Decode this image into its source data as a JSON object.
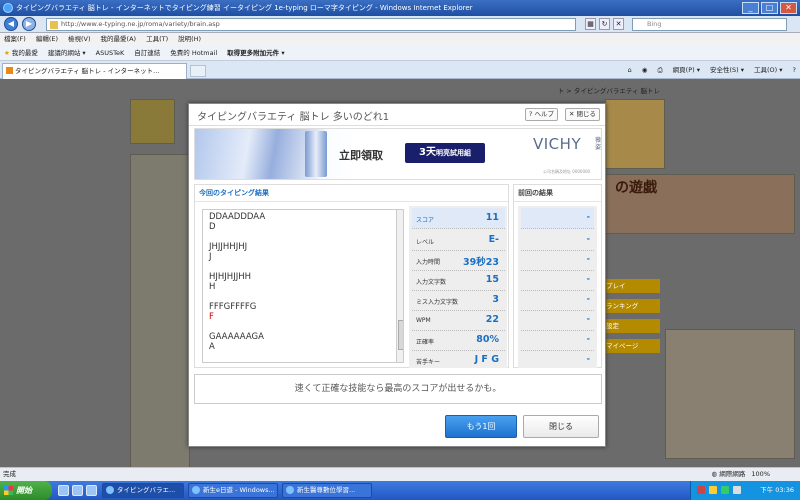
{
  "window": {
    "title": "タイピングバラエティ 脳トレ - インターネットでタイピング練習 イータイピング 1e-typing ローマ字タイピング - Windows Internet Explorer",
    "min": "_",
    "max": "□",
    "close": "✕"
  },
  "address": {
    "url": "http://www.e-typing.ne.jp/roma/variety/brain.asp",
    "search_placeholder": "Bing"
  },
  "menu": [
    "檔案(F)",
    "編輯(E)",
    "檢視(V)",
    "我的最愛(A)",
    "工具(T)",
    "說明(H)"
  ],
  "favorites": {
    "label": "我的最愛",
    "items": [
      "建議的網站 ▾",
      "ASUSTeK",
      "自訂連結",
      "免費的 Hotmail",
      "取得更多附加元件 ▾"
    ]
  },
  "tab": {
    "label": "タイピングバラエティ 脳トレ - インターネット..."
  },
  "commands": [
    "網頁(P) ▾",
    "安全性(S) ▾",
    "工具(O) ▾"
  ],
  "background": {
    "breadcrumb": "ト > タイピングバラエティ 脳トレ",
    "game_title": "の遊戯",
    "side_links": [
      "プレイ",
      "ランキング",
      "設定",
      "マイページ"
    ]
  },
  "dialog": {
    "title": "タイピングバラエティ 脳トレ 多いのどれ1",
    "help": "ヘルプ",
    "close": "閉じる",
    "ad": {
      "lead": "立即領取",
      "offer_main": "3天",
      "offer_sub": "明亮試用組",
      "brand": "VICHY",
      "brand_sub": "薇姿",
      "small": "公司名稱及地址 0000000"
    },
    "current_header": "今回のタイピング結果",
    "previous_header": "前回の結果",
    "words": [
      {
        "q": "DDAADDDAA",
        "a": "D",
        "correct": true
      },
      {
        "q": "JHJJHHJHJ",
        "a": "J",
        "correct": true
      },
      {
        "q": "HJHJHJJHH",
        "a": "H",
        "correct": true
      },
      {
        "q": "FFFGFFFFG",
        "a": "F",
        "correct": false
      },
      {
        "q": "GAAAAAAGA",
        "a": "A",
        "correct": true
      }
    ],
    "stats": [
      {
        "label": "スコア",
        "value": "11",
        "prev": "-"
      },
      {
        "label": "レベル",
        "value": "E-",
        "prev": "-"
      },
      {
        "label": "入力時間",
        "value": "39秒23",
        "prev": "-"
      },
      {
        "label": "入力文字数",
        "value": "15",
        "prev": "-"
      },
      {
        "label": "ミス入力文字数",
        "value": "3",
        "prev": "-"
      },
      {
        "label": "WPM",
        "value": "22",
        "prev": "-"
      },
      {
        "label": "正確率",
        "value": "80%",
        "prev": "-"
      },
      {
        "label": "苦手キー",
        "value": "J F G",
        "prev": "-"
      }
    ],
    "message": "速くて正確な技能なら最高のスコアが出せるかも。",
    "retry": "もう1回",
    "close_button": "閉じる"
  },
  "statusbar": {
    "left": "完成",
    "zone": "網際網路",
    "zoom": "100%"
  },
  "taskbar": {
    "start": "開始",
    "items": [
      "タイピングバラエ...",
      "新生e日遊 - Windows...",
      "新生醫尊數位學習..."
    ],
    "clock": "下午 03:36"
  }
}
